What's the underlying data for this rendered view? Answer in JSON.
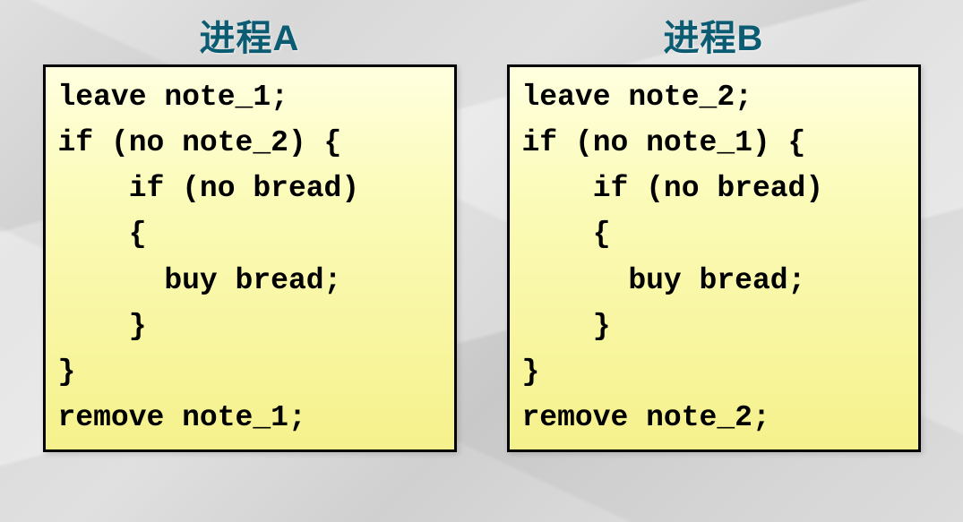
{
  "columns": [
    {
      "title": "进程A",
      "code": "leave note_1;\nif (no note_2) {\n    if (no bread)\n    {\n      buy bread;\n    }\n}\nremove note_1;"
    },
    {
      "title": "进程B",
      "code": "leave note_2;\nif (no note_1) {\n    if (no bread)\n    {\n      buy bread;\n    }\n}\nremove note_2;"
    }
  ]
}
